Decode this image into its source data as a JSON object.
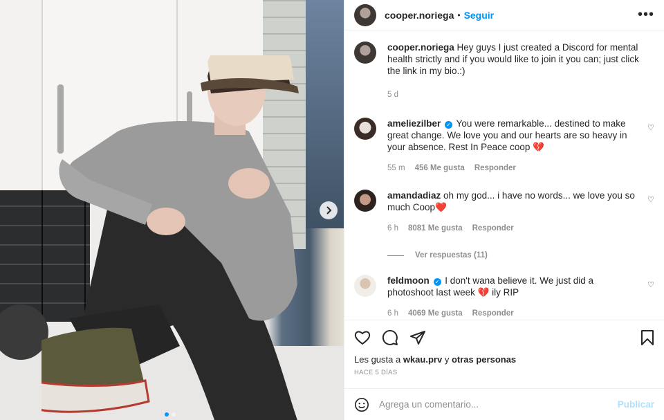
{
  "header": {
    "username": "cooper.noriega",
    "separator": "•",
    "follow_label": "Seguir",
    "more_label": "•••"
  },
  "caption": {
    "username": "cooper.noriega",
    "text": "Hey guys I just created a Discord for mental health strictly and if you would like to join it you can; just click the link in my bio.:)",
    "time": "5 d"
  },
  "comments": [
    {
      "username": "ameliezilber",
      "verified": true,
      "text": "You were remarkable... destined to make great change. We love you and our hearts are so heavy in your absence. Rest In Peace coop 💔",
      "time": "55 m",
      "likes": "456 Me gusta",
      "reply_label": "Responder"
    },
    {
      "username": "amandadiaz",
      "verified": false,
      "text": "oh my god... i have no words... we love you so much Coop❤️",
      "time": "6 h",
      "likes": "8081 Me gusta",
      "reply_label": "Responder",
      "view_replies": "Ver respuestas (11)"
    },
    {
      "username": "feldmoon",
      "verified": true,
      "text": "I don't wana believe it. We just did a photoshoot last week 💔 ily RIP",
      "time": "6 h",
      "likes": "4069 Me gusta",
      "reply_label": "Responder"
    }
  ],
  "likes_line": {
    "prefix": "Les gusta a",
    "user": "wkau.prv",
    "middle": "y",
    "others": "otras personas"
  },
  "date_label": "HACE 5 DÍAS",
  "add_comment": {
    "placeholder": "Agrega un comentario...",
    "post_label": "Publicar"
  },
  "carousel": {
    "current": 1,
    "total": 2
  },
  "colors": {
    "accent": "#0095f6",
    "muted": "#8e8e8e",
    "post_disabled": "#b2dffc"
  },
  "icons": [
    "heart-icon",
    "comment-icon",
    "share-icon",
    "bookmark-icon",
    "emoji-icon",
    "chevron-right-icon",
    "more-icon"
  ]
}
